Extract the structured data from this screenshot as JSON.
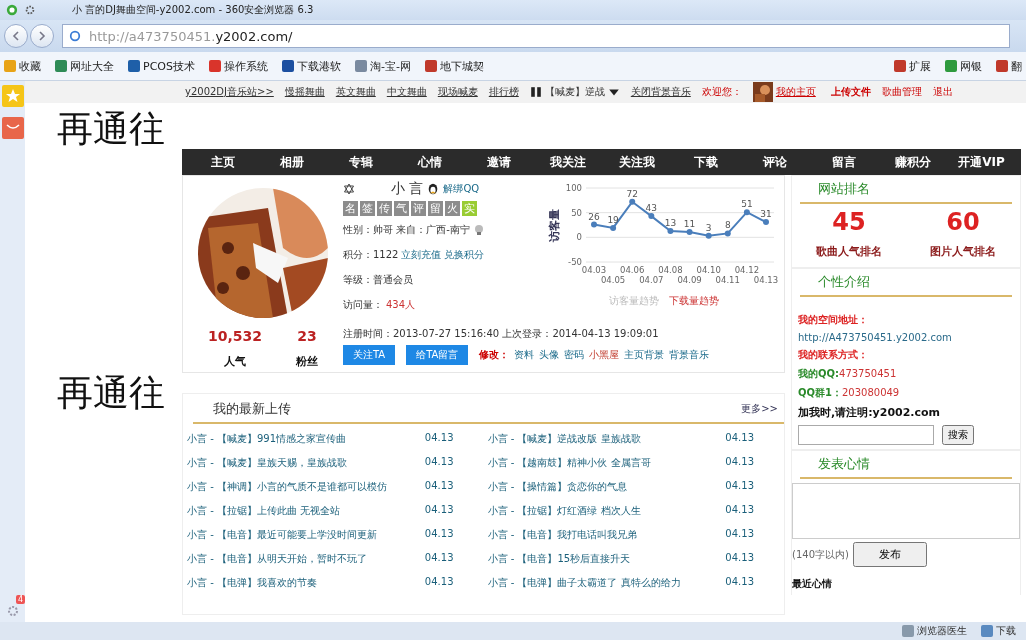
{
  "browser": {
    "title": "小 言的DJ舞曲空间-y2002.com - 360安全浏览器 6.3",
    "address_dim": "http://a473750451.",
    "address_main": "y2002.com/",
    "bookmarks": [
      {
        "label": "收藏",
        "kind": "star"
      },
      {
        "label": "网址大全",
        "kind": "house"
      },
      {
        "label": "PCOS技术",
        "kind": "triangle"
      },
      {
        "label": "操作系统",
        "kind": "swirl"
      },
      {
        "label": "下载港软",
        "kind": "disc"
      },
      {
        "label": "淘-宝-网",
        "kind": "page"
      },
      {
        "label": "地下城契",
        "kind": "tiles"
      }
    ],
    "tools": [
      {
        "label": "扩展",
        "kind": "tiles"
      },
      {
        "label": "网银",
        "kind": "shield"
      },
      {
        "label": "翻",
        "kind": "book"
      }
    ],
    "side_count": "4",
    "status_bar": [
      {
        "label": "浏览器医生",
        "kind": "doctor"
      },
      {
        "label": "下载",
        "kind": "download"
      }
    ]
  },
  "site_nav": {
    "links": [
      "y2002DJ音乐站>>",
      "慢摇舞曲",
      "英文舞曲",
      "中文舞曲",
      "现场喊麦",
      "排行榜"
    ],
    "player": "【喊麦】逆战",
    "close_music": "关闭背景音乐",
    "welcome": "欢迎您：",
    "my_home": "我的主页",
    "actions": [
      "上传文件",
      "歌曲管理",
      "退出"
    ]
  },
  "overlay_texts": [
    "再通往",
    "再通往"
  ],
  "main_nav": [
    "主页",
    "相册",
    "专辑",
    "心情",
    "邀请",
    "我关注",
    "关注我",
    "下载",
    "评论",
    "留言",
    "赚积分",
    "开通VIP"
  ],
  "profile": {
    "name": "小 言",
    "unbind_qq": "解绑QQ",
    "badges": [
      {
        "label": "名",
        "on": false
      },
      {
        "label": "签",
        "on": false
      },
      {
        "label": "传",
        "on": false
      },
      {
        "label": "气",
        "on": false
      },
      {
        "label": "评",
        "on": false
      },
      {
        "label": "留",
        "on": false
      },
      {
        "label": "火",
        "on": false
      },
      {
        "label": "实",
        "on": true
      }
    ],
    "location": "性别：帅哥 来自：广西-南宁",
    "points": "积分：1122",
    "recharge": "立刻充值",
    "exchange": "兑换积分",
    "level": "等级：普通会员",
    "visits_label": "访问量：",
    "visits": "434人",
    "register": "注册时间：2013-07-27 15:16:40 上次登录：2014-04-13 19:09:01",
    "stats": [
      {
        "value": "10,532",
        "label": "人气"
      },
      {
        "value": "23",
        "label": "粉丝"
      }
    ],
    "buttons": [
      "关注TA",
      "给TA留言"
    ],
    "edit_label": "修改：",
    "edit_links": [
      {
        "label": "资料",
        "kind": "normal"
      },
      {
        "label": "头像",
        "kind": "normal"
      },
      {
        "label": "密码",
        "kind": "normal"
      },
      {
        "label": "小黑屋",
        "kind": "warning"
      },
      {
        "label": "主页背景",
        "kind": "normal"
      },
      {
        "label": "背景音乐",
        "kind": "normal"
      }
    ],
    "chart_data": {
      "type": "line",
      "ylabel": "访客量",
      "categories": [
        "04.03",
        "04.05",
        "04.06",
        "04.07",
        "04.08",
        "04.09",
        "04.10",
        "04.11",
        "04.12",
        "04.13"
      ],
      "series": [
        {
          "color": "#4a7ebb",
          "marker": "circle",
          "values": [
            26,
            19,
            72,
            43,
            13,
            11,
            3,
            8,
            51,
            31
          ]
        }
      ],
      "ylim": [
        -50,
        100
      ],
      "yticks": [
        -50,
        0,
        50,
        100
      ],
      "data_labels": true
    },
    "chart_tabs": [
      {
        "label": "访客量趋势",
        "selected": false
      },
      {
        "label": "下载量趋势",
        "selected": true
      }
    ]
  },
  "ranking": {
    "title": "网站排名",
    "items": [
      {
        "value": "45",
        "label": "歌曲人气排名"
      },
      {
        "value": "60",
        "label": "图片人气排名"
      }
    ]
  },
  "intro": {
    "title": "个性介绍",
    "lines": [
      {
        "kind": "heading",
        "label": "我的空间地址："
      },
      {
        "kind": "link",
        "label": "http://A473750451.y2002.com"
      },
      {
        "kind": "heading",
        "label": "我的联系方式："
      },
      {
        "kind": "pair",
        "label": "我的QQ:",
        "value": "473750451"
      },
      {
        "kind": "pair",
        "label": "QQ群1：",
        "value": "203080049"
      },
      {
        "kind": "note",
        "label": "加我时,请注明:y2002.com"
      }
    ],
    "search_button": "搜索"
  },
  "mood": {
    "title": "发表心情",
    "hint": "(140字以内)",
    "button": "发布",
    "recent": "最近心情"
  },
  "uploads": {
    "title": "我的最新上传",
    "more": "更多>>",
    "items": [
      {
        "text": "小言 - 【喊麦】991情感之家宣传曲",
        "date": "04.13"
      },
      {
        "text": "小言 - 【喊麦】逆战改版 皇族战歌",
        "date": "04.13"
      },
      {
        "text": "小言 - 【喊麦】皇族天赐，皇族战歌",
        "date": "04.13"
      },
      {
        "text": "小言 - 【越南鼓】精神小伙 全属言哥",
        "date": "04.13"
      },
      {
        "text": "小言 - 【神调】小言的气质不是谁都可以模仿",
        "date": "04.13"
      },
      {
        "text": "小言 - 【操情篇】贪恋你的气息",
        "date": "04.13"
      },
      {
        "text": "小言 - 【拉锯】上传此曲 无视全站",
        "date": "04.13"
      },
      {
        "text": "小言 - 【拉锯】灯红酒绿 档次人生",
        "date": "04.13"
      },
      {
        "text": "小言 - 【电音】最近可能要上学没时间更新",
        "date": "04.13"
      },
      {
        "text": "小言 - 【电音】我打电话叫我兄弟",
        "date": "04.13"
      },
      {
        "text": "小言 - 【电音】从明天开始，暂时不玩了",
        "date": "04.13"
      },
      {
        "text": "小言 - 【电音】15秒后直接升天",
        "date": "04.13"
      },
      {
        "text": "小言 - 【电弹】我喜欢的节奏",
        "date": "04.13"
      },
      {
        "text": "小言 - 【电弹】曲子太霸道了 真特么的给力",
        "date": "04.13"
      }
    ]
  }
}
